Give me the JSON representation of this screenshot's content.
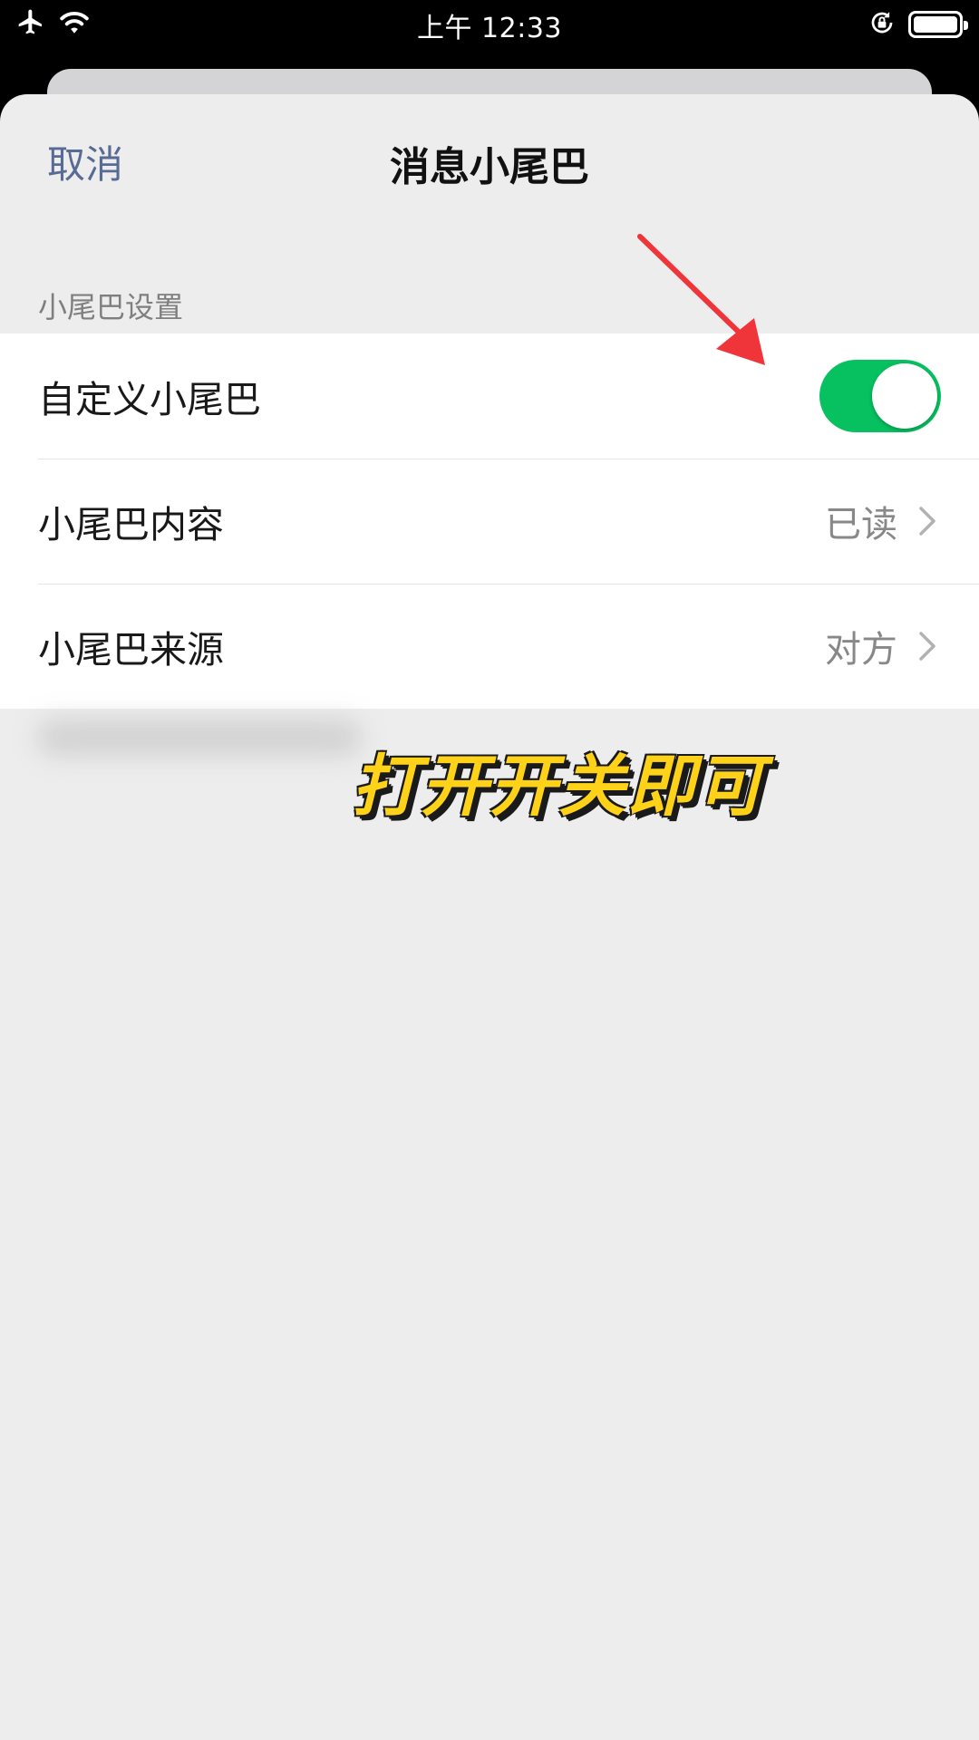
{
  "status_bar": {
    "time": "上午 12:33",
    "icons": [
      "airplane-icon",
      "wifi-icon",
      "rotation-lock-icon",
      "battery-icon"
    ]
  },
  "nav": {
    "cancel_label": "取消",
    "title": "消息小尾巴"
  },
  "section": {
    "header": "小尾巴设置"
  },
  "rows": [
    {
      "label": "自定义小尾巴",
      "type": "toggle",
      "on": true
    },
    {
      "label": "小尾巴内容",
      "value": "已读",
      "type": "link"
    },
    {
      "label": "小尾巴来源",
      "value": "对方",
      "type": "link"
    }
  ],
  "overlay": {
    "caption": "打开开关即可"
  },
  "colors": {
    "accent_link": "#576b95",
    "toggle_on": "#07c160",
    "caption": "#ffd21a",
    "arrow": "#f0353a"
  }
}
